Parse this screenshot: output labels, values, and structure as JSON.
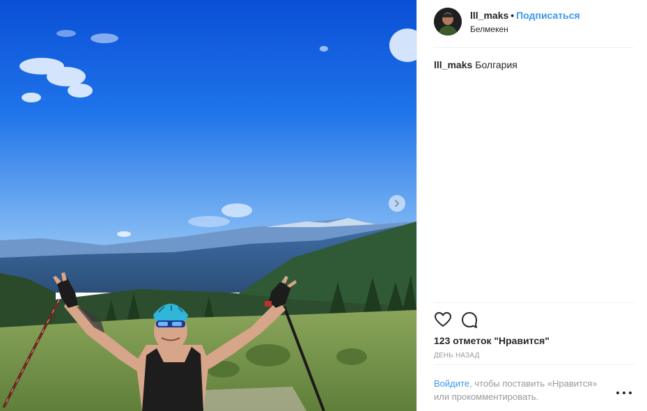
{
  "post": {
    "username": "lll_maks",
    "separator": "•",
    "follow_label": "Подписаться",
    "location": "Белмекен",
    "caption_user": "lll_maks",
    "caption_text": "Болгария",
    "likes_text": "123 отметок \"Нравится\"",
    "time_text": "ДЕНЬ НАЗАД"
  },
  "login_prompt": {
    "link": "Войдите",
    "rest": ", чтобы поставить «Нравится» или прокомментировать."
  },
  "icons": {
    "carousel_next": "chevron-right-icon",
    "like": "heart-icon",
    "comment": "comment-icon",
    "more": "more-options-icon"
  },
  "colors": {
    "link_blue": "#3897f0",
    "text": "#262626",
    "muted": "#999999",
    "divider": "#efefef"
  }
}
